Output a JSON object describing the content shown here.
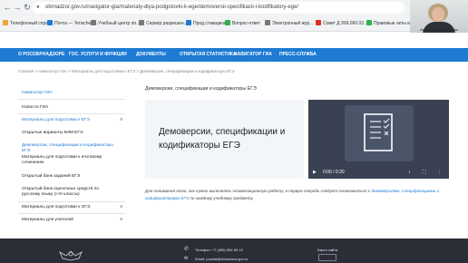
{
  "browser": {
    "url": "obrnadzor.gov.ru/navigator-gia/materialy-dlya-podgotovki-k-ege/demoversii-specifikacii-i-kodifikatory-ege/",
    "bookmarks": [
      "Телефонный справ...",
      "Почта — Tenschen...",
      "Учебный центр по...",
      "Сервер разрешен...",
      "Прод.ставщика",
      "Вопрос-ответ",
      "Электронный жур...",
      "Совет Д 999.060.02...",
      "Правовые акты в..."
    ],
    "webcam_caption": "Анастасия Тимощенко"
  },
  "topnav": [
    "О РОСОБРНАДЗОРЕ",
    "ГОС. УСЛУГИ И ФУНКЦИИ",
    "ДОКУМЕНТЫ",
    "ОТКРЫТАЯ СТАТИСТИКА",
    "НАВИГАТОР ГИА",
    "ПРЕСС-СЛУЖБА"
  ],
  "breadcrumb": "Главная > Навигатор ГИА > Материалы для подготовки к ЕГЭ > Демоверсии, спецификации и кодификаторы ЕГЭ",
  "sidebar": {
    "items": [
      "Навигатор ГИА",
      "Новости ГИА",
      "Материалы для подготовки к ЕГЭ",
      "Открытые варианты КИМ ЕГЭ",
      "Демоверсии, спецификации и кодификаторы ЕГЭ",
      "Материалы для подготовки к итоговому сочинению",
      "Открытый банк заданий ЕГЭ",
      "Открытый банк оценочных средств по русскому языку (I-XI классы)",
      "Материалы для подготовки к ОГЭ",
      "Материалы для учителей"
    ]
  },
  "main": {
    "title": "Демоверсии, спецификации и кодификаторы ЕГЭ",
    "card_title": "Демоверсии, спецификации и кодификаторы ЕГЭ",
    "video_time": "0:00 / 0:20",
    "desc_before": "Для понимания того, как нужно выполнять экзаменационную работу, в первую очередь следует ознакомиться с",
    "desc_link": "демоверсиями, спецификациями и кодификаторами ЕГЭ",
    "desc_after": "по каждому учебному предмету"
  },
  "footer": {
    "phone": "Телефон: +7 (495) 984 89 19",
    "email": "Email: poshta@obrnadzor.gov.ru",
    "sitemap": "Карта сайта"
  },
  "colors": {
    "accent": "#1d7bd3",
    "footer": "#2b2e37"
  }
}
